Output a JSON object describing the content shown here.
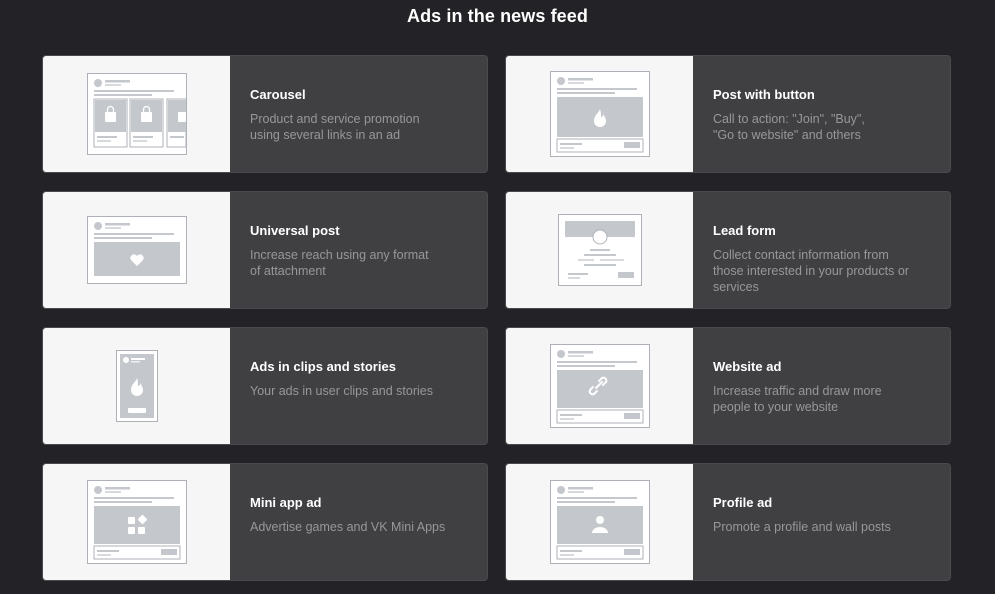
{
  "page": {
    "title": "Ads in the news feed"
  },
  "cards": [
    {
      "title": "Carousel",
      "description": "Product and service promotion\nusing several links in an ad",
      "icon": "carousel-icon"
    },
    {
      "title": "Post with button",
      "description": "Call to action: \"Join\", \"Buy\",\n\"Go to website\" and others",
      "icon": "post-with-button-icon"
    },
    {
      "title": "Universal post",
      "description": "Increase reach using any format\nof attachment",
      "icon": "universal-post-icon"
    },
    {
      "title": "Lead form",
      "description": "Collect contact information from\nthose interested in your products or\nservices",
      "icon": "lead-form-icon"
    },
    {
      "title": "Ads in clips and stories",
      "description": "Your ads in user clips and stories",
      "icon": "clips-stories-icon"
    },
    {
      "title": "Website ad",
      "description": "Increase traffic and draw more\npeople to your website",
      "icon": "website-ad-icon"
    },
    {
      "title": "Mini app ad",
      "description": "Advertise games and VK Mini Apps",
      "icon": "mini-app-ad-icon"
    },
    {
      "title": "Profile ad",
      "description": "Promote a profile and wall posts",
      "icon": "profile-ad-icon"
    }
  ],
  "colors": {
    "background": "#232327",
    "card_body": "#404043",
    "illustration_bg": "#f6f6f7",
    "title_text": "#ffffff",
    "desc_text": "#97979c"
  }
}
